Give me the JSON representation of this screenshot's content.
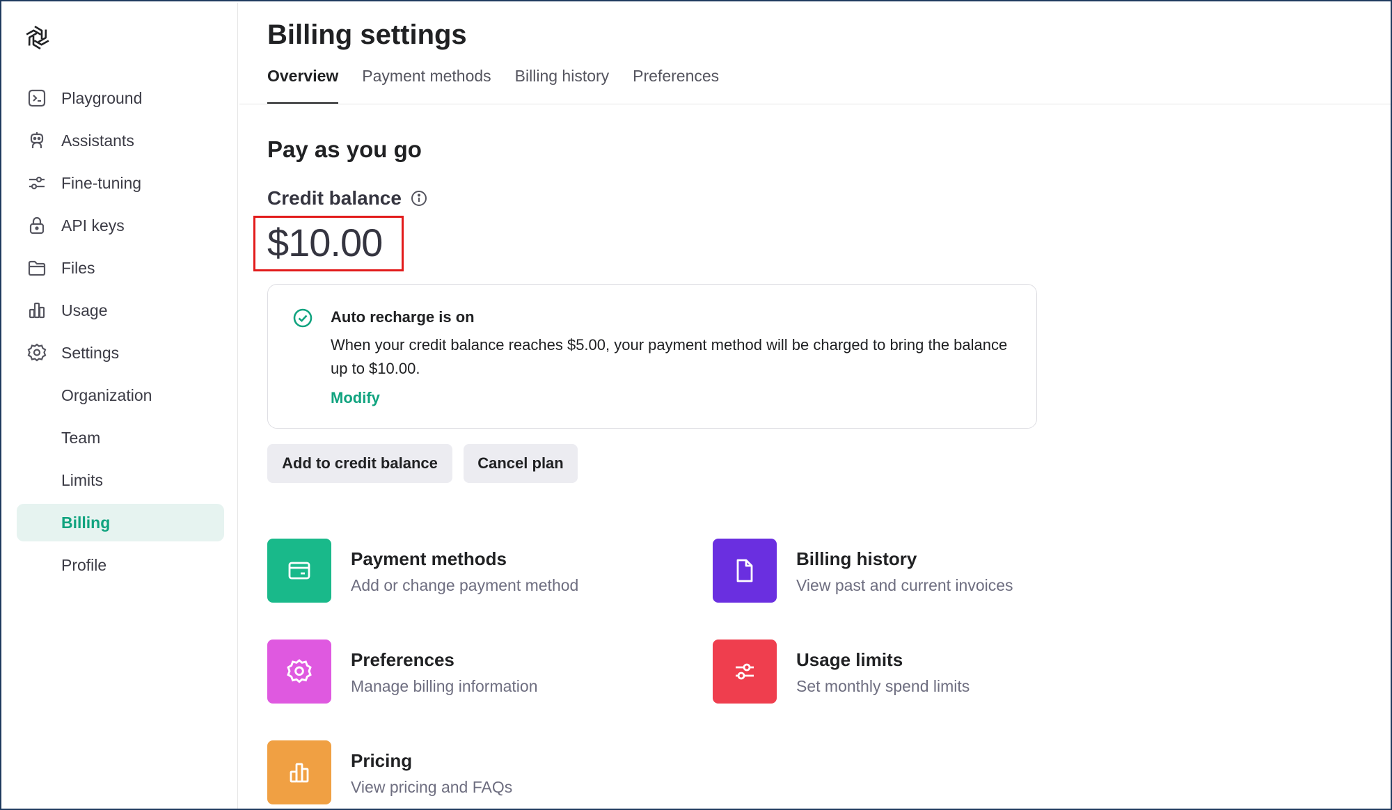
{
  "sidebar": {
    "logo": "openai-logo",
    "items": [
      {
        "label": "Playground",
        "icon": "terminal-icon"
      },
      {
        "label": "Assistants",
        "icon": "robot-icon"
      },
      {
        "label": "Fine-tuning",
        "icon": "sliders-icon"
      },
      {
        "label": "API keys",
        "icon": "lock-icon"
      },
      {
        "label": "Files",
        "icon": "folder-icon"
      },
      {
        "label": "Usage",
        "icon": "bar-chart-icon"
      },
      {
        "label": "Settings",
        "icon": "gear-icon"
      }
    ],
    "sub_items": [
      {
        "label": "Organization"
      },
      {
        "label": "Team"
      },
      {
        "label": "Limits"
      },
      {
        "label": "Billing",
        "active": true
      },
      {
        "label": "Profile"
      }
    ]
  },
  "header": {
    "title": "Billing settings",
    "tabs": [
      {
        "label": "Overview",
        "active": true
      },
      {
        "label": "Payment methods"
      },
      {
        "label": "Billing history"
      },
      {
        "label": "Preferences"
      }
    ]
  },
  "plan": {
    "title": "Pay as you go",
    "credit_label": "Credit balance",
    "credit_value": "$10.00"
  },
  "auto_recharge": {
    "title": "Auto recharge is on",
    "text": "When your credit balance reaches $5.00, your payment method will be charged to bring the balance up to $10.00.",
    "link": "Modify"
  },
  "buttons": {
    "add": "Add to credit balance",
    "cancel": "Cancel plan"
  },
  "tiles": [
    {
      "title": "Payment methods",
      "subtitle": "Add or change payment method",
      "color": "#19b98a",
      "icon": "credit-card-icon"
    },
    {
      "title": "Billing history",
      "subtitle": "View past and current invoices",
      "color": "#6a2fe0",
      "icon": "document-icon"
    },
    {
      "title": "Preferences",
      "subtitle": "Manage billing information",
      "color": "#df59e0",
      "icon": "gear-icon"
    },
    {
      "title": "Usage limits",
      "subtitle": "Set monthly spend limits",
      "color": "#ef3e4e",
      "icon": "sliders-icon"
    },
    {
      "title": "Pricing",
      "subtitle": "View pricing and FAQs",
      "color": "#f0a043",
      "icon": "bar-chart-icon"
    }
  ],
  "colors": {
    "accent": "#10a37f",
    "highlight_box": "#e21b1b"
  }
}
